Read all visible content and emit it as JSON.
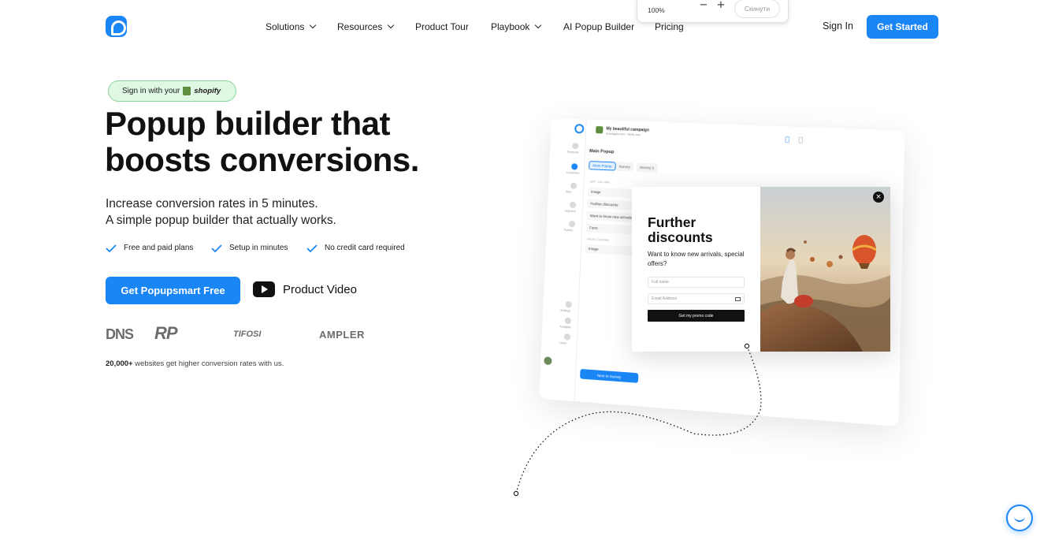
{
  "header": {
    "nav": [
      {
        "label": "Solutions",
        "has_dropdown": true
      },
      {
        "label": "Resources",
        "has_dropdown": true
      },
      {
        "label": "Product Tour",
        "has_dropdown": false
      },
      {
        "label": "Playbook",
        "has_dropdown": true
      },
      {
        "label": "AI Popup Builder",
        "has_dropdown": false
      },
      {
        "label": "Pricing",
        "has_dropdown": false
      }
    ],
    "sign_in": "Sign In",
    "get_started": "Get Started"
  },
  "zoom_popup": {
    "level": "100%",
    "minus": "−",
    "plus": "+",
    "reset": "Скинути"
  },
  "hero": {
    "shopify_prefix": "Sign in with your",
    "shopify_brand": "shopify",
    "headline_line1": "Popup builder that",
    "headline_line2": "boosts conversions.",
    "sub_line1": "Increase conversion rates in 5 minutes.",
    "sub_line2": "A simple popup builder that actually works.",
    "features": [
      "Free and paid plans",
      "Setup in minutes",
      "No credit card required"
    ],
    "cta": "Get Popupsmart Free",
    "video": "Product Video",
    "brands": [
      "DNS",
      "RP",
      "TIFOSI",
      "AMPLER"
    ],
    "stat_bold": "20,000+",
    "stat_rest": " websites get higher conversion rates with us."
  },
  "mockup": {
    "campaign_title": "My beautiful campaign",
    "campaign_sub": "ecomapps.com · Verify now",
    "panel_title": "Main Popup",
    "tabs": [
      "Main Popup",
      "Survey",
      "Survey 2"
    ],
    "section_left": "LEFT COLUMN",
    "rows": [
      "Image",
      "Further discounts",
      "Want to know new arrivals,",
      "Form"
    ],
    "section_right": "RIGHT COLUMN",
    "right_rows": [
      "Image"
    ],
    "side_items": [
      "Playbook",
      "Customize",
      "Style",
      "Segment",
      "Publish",
      "Settings",
      "Analytics",
      "Leads"
    ],
    "next_button": "Next to Survey"
  },
  "popup": {
    "title_line1": "Further",
    "title_line2": "discounts",
    "desc": "Want to know new arrivals, special offers?",
    "name_placeholder": "Full name",
    "email_placeholder": "Email Address",
    "button": "Get my promo code",
    "close": "×"
  },
  "colors": {
    "accent": "#1a86f5",
    "shopify_green": "#5e8e3e",
    "pill_bg": "#dff8e3",
    "check": "#1a86f5"
  }
}
